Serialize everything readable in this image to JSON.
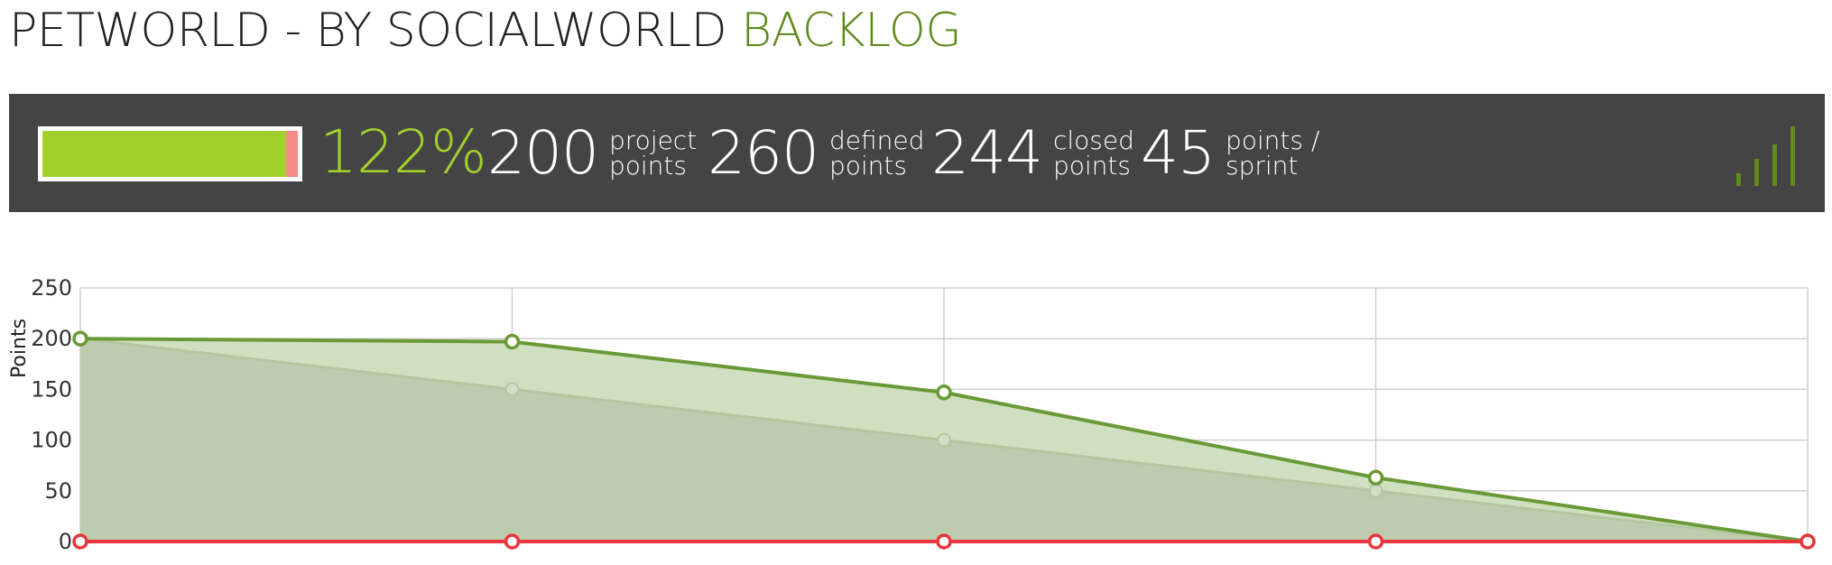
{
  "header": {
    "title_main": "PETWORLD - BY SOCIALWORLD",
    "title_accent": "BACKLOG"
  },
  "stats": {
    "progress_percent_text": "122%",
    "progress_fraction": 1.22,
    "project_points": "200",
    "project_points_label": "project points",
    "defined_points": "260",
    "defined_points_label": "defined points",
    "closed_points": "244",
    "closed_points_label": "closed points",
    "points_per_sprint": "45",
    "points_per_sprint_label": "points / sprint",
    "signal_icon": "signal-bars-icon"
  },
  "colors": {
    "accent_green": "#a3cf2d",
    "dark_green": "#5f8a1c",
    "overflow_pink": "#f58a88",
    "bar_bg": "#444444",
    "red_line": "#e8363c"
  },
  "chart_data": {
    "type": "area",
    "ylabel": "Points",
    "xlabel": "",
    "ylim": [
      0,
      250
    ],
    "yticks": [
      0,
      50,
      100,
      150,
      200,
      250
    ],
    "x": [
      1,
      2,
      3,
      4,
      5
    ],
    "series": [
      {
        "values": [
          200,
          197,
          147,
          63,
          0
        ],
        "color": "#6a9a37"
      },
      {
        "values": [
          200,
          150,
          100,
          50,
          0
        ],
        "color": "#b5c7a0"
      },
      {
        "values": [
          0,
          0,
          0,
          0,
          0
        ],
        "color": "#e8363c"
      }
    ],
    "grid": true
  }
}
